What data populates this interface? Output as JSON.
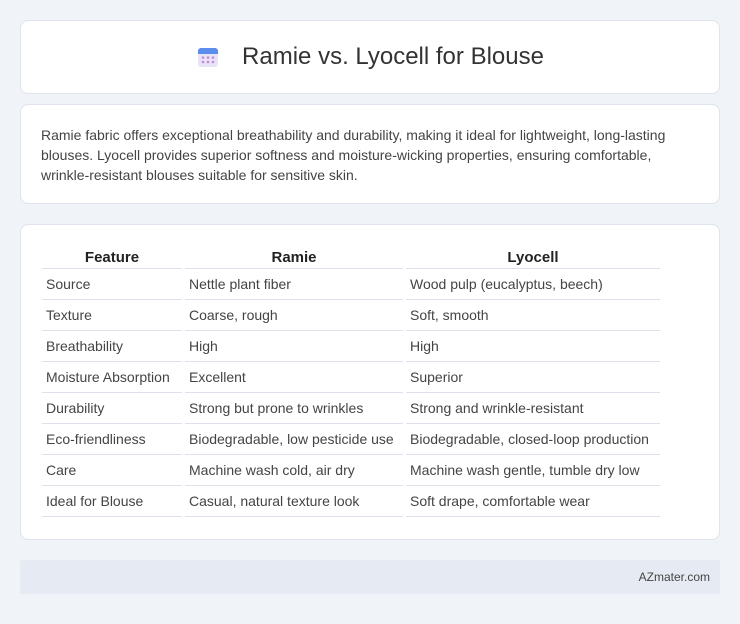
{
  "header": {
    "title": "Ramie vs. Lyocell for Blouse",
    "icon": "calendar-icon"
  },
  "intro": {
    "text": "Ramie fabric offers exceptional breathability and durability, making it ideal for lightweight, long-lasting blouses. Lyocell provides superior softness and moisture-wicking properties, ensuring comfortable, wrinkle-resistant blouses suitable for sensitive skin."
  },
  "table": {
    "headers": [
      "Feature",
      "Ramie",
      "Lyocell"
    ],
    "rows": [
      [
        "Source",
        "Nettle plant fiber",
        "Wood pulp (eucalyptus, beech)"
      ],
      [
        "Texture",
        "Coarse, rough",
        "Soft, smooth"
      ],
      [
        "Breathability",
        "High",
        "High"
      ],
      [
        "Moisture Absorption",
        "Excellent",
        "Superior"
      ],
      [
        "Durability",
        "Strong but prone to wrinkles",
        "Strong and wrinkle-resistant"
      ],
      [
        "Eco-friendliness",
        "Biodegradable, low pesticide use",
        "Biodegradable, closed-loop production"
      ],
      [
        "Care",
        "Machine wash cold, air dry",
        "Machine wash gentle, tumble dry low"
      ],
      [
        "Ideal for Blouse",
        "Casual, natural texture look",
        "Soft drape, comfortable wear"
      ]
    ]
  },
  "footer": {
    "text": "AZmater.com"
  }
}
